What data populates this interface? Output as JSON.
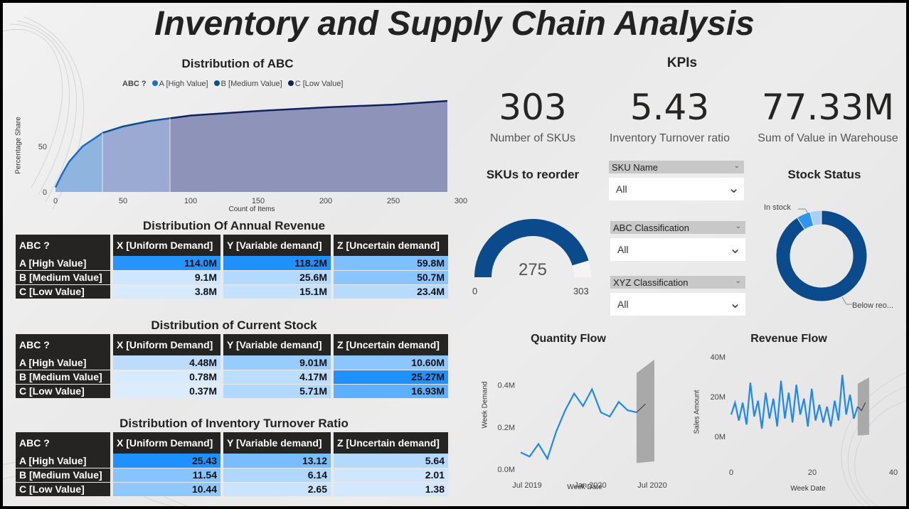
{
  "title": "Inventory and Supply Chain Analysis",
  "abc_chart": {
    "title": "Distribution of ABC",
    "legend_title": "ABC ?",
    "legend": [
      "A [High Value]",
      "B [Medium Value]",
      "C [Low Value]"
    ],
    "colors": [
      "#1a6fc4",
      "#0a4f8f",
      "#12205e"
    ],
    "ylabel": "Percentage Share",
    "xlabel": "Count of Items",
    "y_ticks": [
      "0",
      "50"
    ],
    "x_ticks": [
      "0",
      "50",
      "100",
      "150",
      "200",
      "250",
      "300"
    ]
  },
  "revenue_table": {
    "title": "Distribution Of Annual Revenue",
    "headers": [
      "ABC ?",
      "X [Uniform Demand]",
      "Y [Variable demand]",
      "Z [Uncertain demand]"
    ],
    "rows": [
      {
        "label": "A [High Value]",
        "cells": [
          "114.0M",
          "118.2M",
          "59.8M"
        ],
        "levels": [
          0.96,
          1.0,
          0.5
        ]
      },
      {
        "label": "B [Medium Value]",
        "cells": [
          "9.1M",
          "25.6M",
          "50.7M"
        ],
        "levels": [
          0.08,
          0.22,
          0.43
        ]
      },
      {
        "label": "C [Low Value]",
        "cells": [
          "3.8M",
          "15.1M",
          "23.4M"
        ],
        "levels": [
          0.03,
          0.13,
          0.2
        ]
      }
    ]
  },
  "stock_table": {
    "title": "Distribution of Current Stock",
    "headers": [
      "ABC ?",
      "X [Uniform Demand]",
      "Y [Variable demand]",
      "Z [Uncertain demand]"
    ],
    "rows": [
      {
        "label": "A [High Value]",
        "cells": [
          "4.48M",
          "9.01M",
          "10.60M"
        ],
        "levels": [
          0.18,
          0.36,
          0.42
        ]
      },
      {
        "label": "B [Medium Value]",
        "cells": [
          "0.78M",
          "4.17M",
          "25.27M"
        ],
        "levels": [
          0.03,
          0.17,
          1.0
        ]
      },
      {
        "label": "C [Low Value]",
        "cells": [
          "0.37M",
          "5.71M",
          "16.93M"
        ],
        "levels": [
          0.01,
          0.23,
          0.67
        ]
      }
    ]
  },
  "turnover_table": {
    "title": "Distribution of Inventory Turnover Ratio",
    "headers": [
      "ABC ?",
      "X [Uniform Demand]",
      "Y [Variable demand]",
      "Z [Uncertain demand]"
    ],
    "rows": [
      {
        "label": "A [High Value]",
        "cells": [
          "25.43",
          "13.12",
          "5.64"
        ],
        "levels": [
          1.0,
          0.52,
          0.22
        ]
      },
      {
        "label": "B [Medium Value]",
        "cells": [
          "11.54",
          "6.14",
          "2.01"
        ],
        "levels": [
          0.45,
          0.24,
          0.08
        ]
      },
      {
        "label": "C [Low Value]",
        "cells": [
          "10.44",
          "2.65",
          "1.38"
        ],
        "levels": [
          0.41,
          0.1,
          0.05
        ]
      }
    ]
  },
  "kpis": {
    "title": "KPIs",
    "items": [
      {
        "value": "303",
        "label": "Number of SKUs"
      },
      {
        "value": "5.43",
        "label": "Inventory Turnover ratio"
      },
      {
        "value": "77.33M",
        "label": "Sum of Value in Warehouse"
      }
    ]
  },
  "gauge": {
    "title": "SKUs to reorder",
    "value_label": "275",
    "min_label": "0",
    "max_label": "303",
    "value": 275,
    "max": 303
  },
  "slicers": [
    {
      "label": "SKU Name",
      "value": "All"
    },
    {
      "label": "ABC Classification",
      "value": "All"
    },
    {
      "label": "XYZ Classification",
      "value": "All"
    }
  ],
  "stock_status": {
    "title": "Stock Status",
    "label_in": "In stock",
    "label_below": "Below reo...",
    "in_stock_fraction": 0.09
  },
  "quantity_flow": {
    "title": "Quantity Flow",
    "ylabel": "Week Demand",
    "xlabel": "Week Date",
    "y_ticks": [
      "0.4M",
      "0.2M",
      "0.0M"
    ],
    "x_ticks": [
      "Jul 2019",
      "Jan 2020",
      "Jul 2020"
    ]
  },
  "revenue_flow": {
    "title": "Revenue Flow",
    "ylabel": "Sales Amount",
    "xlabel": "Week Date",
    "y_ticks": [
      "40M",
      "20M",
      "0M"
    ],
    "x_ticks": [
      "0",
      "20",
      "40"
    ]
  },
  "chart_data": [
    {
      "type": "area",
      "title": "Distribution of ABC",
      "xlabel": "Count of Items",
      "ylabel": "Percentage Share",
      "xlim": [
        0,
        300
      ],
      "ylim": [
        0,
        100
      ],
      "x": [
        0,
        5,
        10,
        20,
        30,
        35,
        50,
        70,
        85,
        100,
        150,
        200,
        250,
        290
      ],
      "y": [
        5,
        20,
        33,
        50,
        60,
        65,
        72,
        78,
        81,
        84,
        89,
        93,
        96,
        100
      ],
      "segments": [
        {
          "name": "A [High Value]",
          "x_end": 35
        },
        {
          "name": "B [Medium Value]",
          "x_end": 85
        },
        {
          "name": "C [Low Value]",
          "x_end": 290
        }
      ]
    },
    {
      "type": "line",
      "title": "Quantity Flow",
      "xlabel": "Week Date",
      "ylabel": "Week Demand",
      "ylim": [
        0,
        0.5
      ],
      "x": [
        "2019-06",
        "2019-07",
        "2019-08",
        "2019-09",
        "2019-10",
        "2019-11",
        "2019-12",
        "2020-01",
        "2020-02",
        "2020-03",
        "2020-04",
        "2020-05",
        "2020-06",
        "2020-07"
      ],
      "values": [
        0.08,
        0.06,
        0.12,
        0.05,
        0.18,
        0.28,
        0.36,
        0.3,
        0.38,
        0.27,
        0.25,
        0.32,
        0.28,
        0.27
      ],
      "forecast": [
        0.27,
        0.31
      ]
    },
    {
      "type": "line",
      "title": "Revenue Flow",
      "xlabel": "Week Date",
      "ylabel": "Sales Amount",
      "ylim": [
        -10,
        40
      ],
      "x": [
        1,
        2,
        3,
        4,
        5,
        6,
        7,
        8,
        9,
        10,
        11,
        12,
        13,
        14,
        15,
        16,
        17,
        18,
        19,
        20,
        21,
        22,
        23,
        24,
        25,
        26,
        27,
        28,
        29,
        30,
        31,
        32,
        33,
        34
      ],
      "values": [
        11,
        17,
        8,
        17,
        6,
        27,
        10,
        18,
        4,
        22,
        9,
        19,
        5,
        28,
        9,
        22,
        7,
        26,
        11,
        19,
        5,
        24,
        8,
        16,
        7,
        15,
        5,
        18,
        8,
        31,
        11,
        21,
        9,
        15
      ],
      "forecast": [
        15,
        13,
        17
      ]
    }
  ]
}
